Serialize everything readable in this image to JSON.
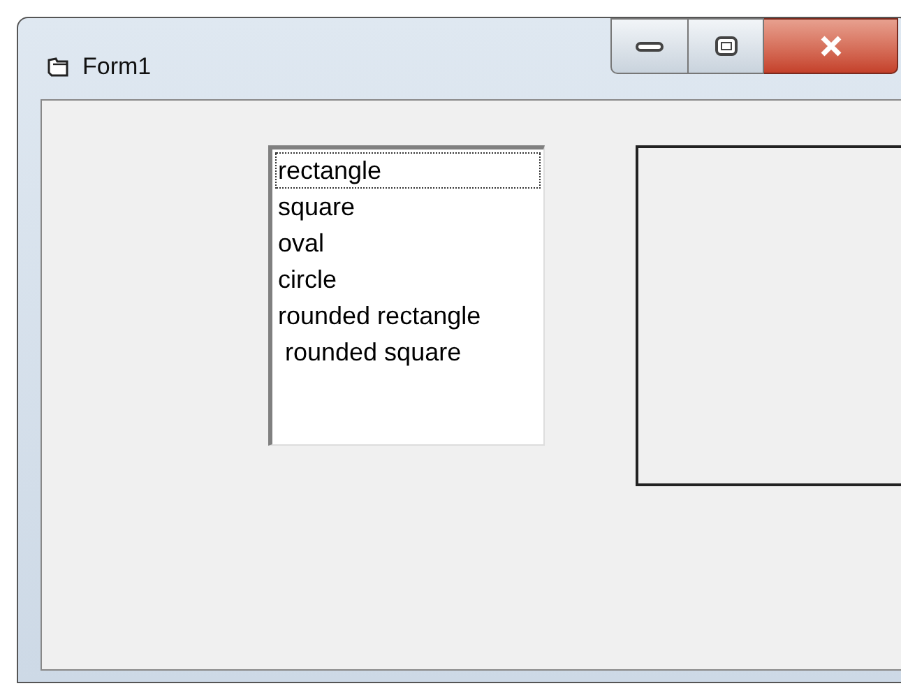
{
  "window": {
    "title": "Form1"
  },
  "listbox": {
    "items": [
      {
        "label": "rectangle",
        "focused": true
      },
      {
        "label": "square",
        "focused": false
      },
      {
        "label": "oval",
        "focused": false
      },
      {
        "label": "circle",
        "focused": false
      },
      {
        "label": "rounded rectangle",
        "focused": false
      },
      {
        "label": " rounded square",
        "focused": false
      }
    ]
  }
}
